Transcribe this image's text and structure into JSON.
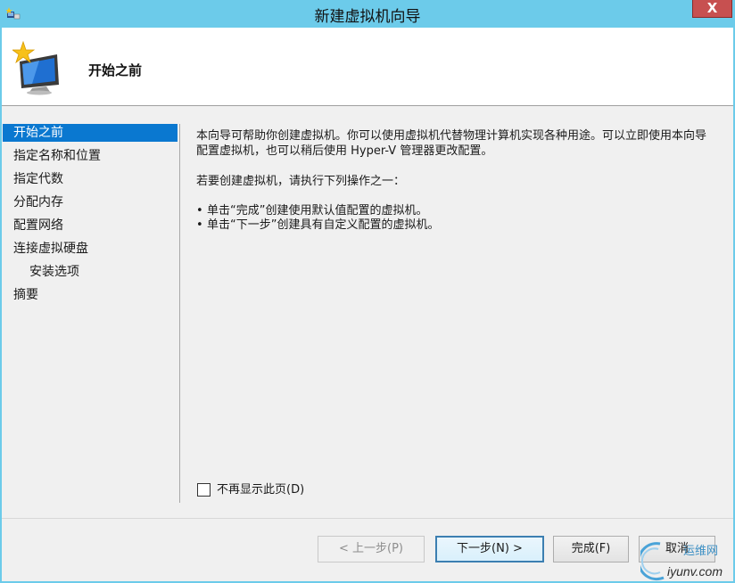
{
  "window": {
    "title": "新建虚拟机向导",
    "close_glyph": "X"
  },
  "header": {
    "title": "开始之前",
    "icon": "monitor-star-icon"
  },
  "nav": {
    "items": [
      {
        "label": "开始之前",
        "active": true,
        "sub": false
      },
      {
        "label": "指定名称和位置",
        "active": false,
        "sub": false
      },
      {
        "label": "指定代数",
        "active": false,
        "sub": false
      },
      {
        "label": "分配内存",
        "active": false,
        "sub": false
      },
      {
        "label": "配置网络",
        "active": false,
        "sub": false
      },
      {
        "label": "连接虚拟硬盘",
        "active": false,
        "sub": false
      },
      {
        "label": "安装选项",
        "active": false,
        "sub": true
      },
      {
        "label": "摘要",
        "active": false,
        "sub": false
      }
    ]
  },
  "content": {
    "intro": "本向导可帮助你创建虚拟机。你可以使用虚拟机代替物理计算机实现各种用途。可以立即使用本向导配置虚拟机，也可以稍后使用 Hyper-V 管理器更改配置。",
    "instruction": "若要创建虚拟机，请执行下列操作之一：",
    "bullets": [
      "单击“完成”创建使用默认值配置的虚拟机。",
      "单击“下一步”创建具有自定义配置的虚拟机。"
    ]
  },
  "checkbox": {
    "label": "不再显示此页(D)",
    "checked": false
  },
  "buttons": {
    "prev": "< 上一步(P)",
    "next": "下一步(N) >",
    "finish": "完成(F)",
    "cancel": "取消"
  },
  "watermark": {
    "text_top": "运维网",
    "text_bottom": "iyunv.com"
  }
}
